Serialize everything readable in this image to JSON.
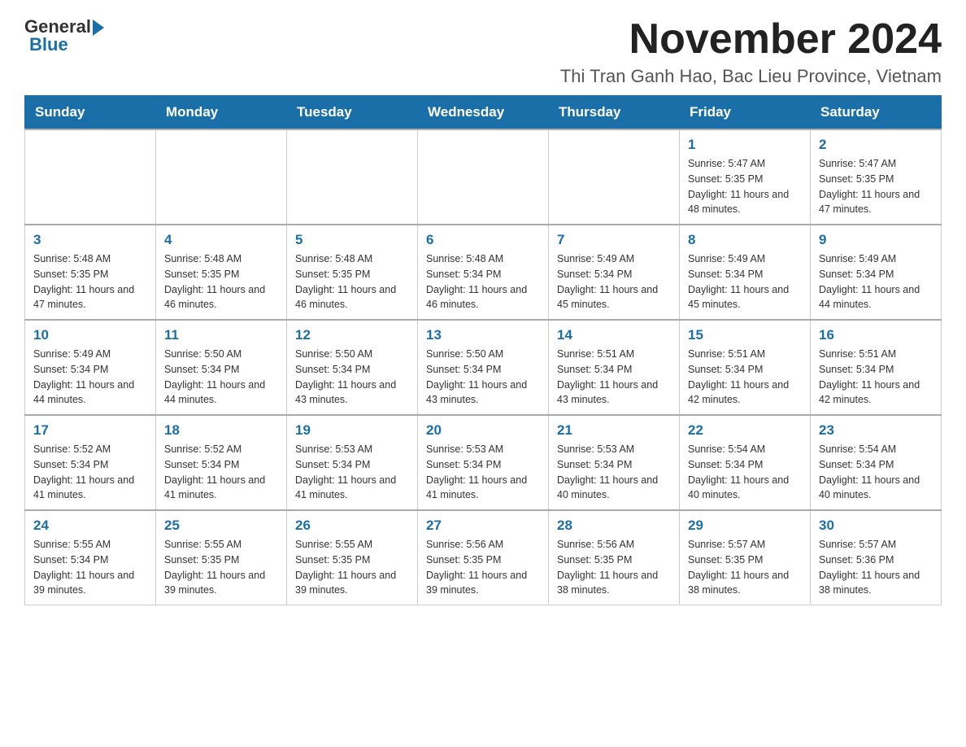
{
  "logo": {
    "general": "General",
    "blue": "Blue"
  },
  "title": "November 2024",
  "subtitle": "Thi Tran Ganh Hao, Bac Lieu Province, Vietnam",
  "days_of_week": [
    "Sunday",
    "Monday",
    "Tuesday",
    "Wednesday",
    "Thursday",
    "Friday",
    "Saturday"
  ],
  "weeks": [
    [
      {
        "day": "",
        "sunrise": "",
        "sunset": "",
        "daylight": ""
      },
      {
        "day": "",
        "sunrise": "",
        "sunset": "",
        "daylight": ""
      },
      {
        "day": "",
        "sunrise": "",
        "sunset": "",
        "daylight": ""
      },
      {
        "day": "",
        "sunrise": "",
        "sunset": "",
        "daylight": ""
      },
      {
        "day": "",
        "sunrise": "",
        "sunset": "",
        "daylight": ""
      },
      {
        "day": "1",
        "sunrise": "Sunrise: 5:47 AM",
        "sunset": "Sunset: 5:35 PM",
        "daylight": "Daylight: 11 hours and 48 minutes."
      },
      {
        "day": "2",
        "sunrise": "Sunrise: 5:47 AM",
        "sunset": "Sunset: 5:35 PM",
        "daylight": "Daylight: 11 hours and 47 minutes."
      }
    ],
    [
      {
        "day": "3",
        "sunrise": "Sunrise: 5:48 AM",
        "sunset": "Sunset: 5:35 PM",
        "daylight": "Daylight: 11 hours and 47 minutes."
      },
      {
        "day": "4",
        "sunrise": "Sunrise: 5:48 AM",
        "sunset": "Sunset: 5:35 PM",
        "daylight": "Daylight: 11 hours and 46 minutes."
      },
      {
        "day": "5",
        "sunrise": "Sunrise: 5:48 AM",
        "sunset": "Sunset: 5:35 PM",
        "daylight": "Daylight: 11 hours and 46 minutes."
      },
      {
        "day": "6",
        "sunrise": "Sunrise: 5:48 AM",
        "sunset": "Sunset: 5:34 PM",
        "daylight": "Daylight: 11 hours and 46 minutes."
      },
      {
        "day": "7",
        "sunrise": "Sunrise: 5:49 AM",
        "sunset": "Sunset: 5:34 PM",
        "daylight": "Daylight: 11 hours and 45 minutes."
      },
      {
        "day": "8",
        "sunrise": "Sunrise: 5:49 AM",
        "sunset": "Sunset: 5:34 PM",
        "daylight": "Daylight: 11 hours and 45 minutes."
      },
      {
        "day": "9",
        "sunrise": "Sunrise: 5:49 AM",
        "sunset": "Sunset: 5:34 PM",
        "daylight": "Daylight: 11 hours and 44 minutes."
      }
    ],
    [
      {
        "day": "10",
        "sunrise": "Sunrise: 5:49 AM",
        "sunset": "Sunset: 5:34 PM",
        "daylight": "Daylight: 11 hours and 44 minutes."
      },
      {
        "day": "11",
        "sunrise": "Sunrise: 5:50 AM",
        "sunset": "Sunset: 5:34 PM",
        "daylight": "Daylight: 11 hours and 44 minutes."
      },
      {
        "day": "12",
        "sunrise": "Sunrise: 5:50 AM",
        "sunset": "Sunset: 5:34 PM",
        "daylight": "Daylight: 11 hours and 43 minutes."
      },
      {
        "day": "13",
        "sunrise": "Sunrise: 5:50 AM",
        "sunset": "Sunset: 5:34 PM",
        "daylight": "Daylight: 11 hours and 43 minutes."
      },
      {
        "day": "14",
        "sunrise": "Sunrise: 5:51 AM",
        "sunset": "Sunset: 5:34 PM",
        "daylight": "Daylight: 11 hours and 43 minutes."
      },
      {
        "day": "15",
        "sunrise": "Sunrise: 5:51 AM",
        "sunset": "Sunset: 5:34 PM",
        "daylight": "Daylight: 11 hours and 42 minutes."
      },
      {
        "day": "16",
        "sunrise": "Sunrise: 5:51 AM",
        "sunset": "Sunset: 5:34 PM",
        "daylight": "Daylight: 11 hours and 42 minutes."
      }
    ],
    [
      {
        "day": "17",
        "sunrise": "Sunrise: 5:52 AM",
        "sunset": "Sunset: 5:34 PM",
        "daylight": "Daylight: 11 hours and 41 minutes."
      },
      {
        "day": "18",
        "sunrise": "Sunrise: 5:52 AM",
        "sunset": "Sunset: 5:34 PM",
        "daylight": "Daylight: 11 hours and 41 minutes."
      },
      {
        "day": "19",
        "sunrise": "Sunrise: 5:53 AM",
        "sunset": "Sunset: 5:34 PM",
        "daylight": "Daylight: 11 hours and 41 minutes."
      },
      {
        "day": "20",
        "sunrise": "Sunrise: 5:53 AM",
        "sunset": "Sunset: 5:34 PM",
        "daylight": "Daylight: 11 hours and 41 minutes."
      },
      {
        "day": "21",
        "sunrise": "Sunrise: 5:53 AM",
        "sunset": "Sunset: 5:34 PM",
        "daylight": "Daylight: 11 hours and 40 minutes."
      },
      {
        "day": "22",
        "sunrise": "Sunrise: 5:54 AM",
        "sunset": "Sunset: 5:34 PM",
        "daylight": "Daylight: 11 hours and 40 minutes."
      },
      {
        "day": "23",
        "sunrise": "Sunrise: 5:54 AM",
        "sunset": "Sunset: 5:34 PM",
        "daylight": "Daylight: 11 hours and 40 minutes."
      }
    ],
    [
      {
        "day": "24",
        "sunrise": "Sunrise: 5:55 AM",
        "sunset": "Sunset: 5:34 PM",
        "daylight": "Daylight: 11 hours and 39 minutes."
      },
      {
        "day": "25",
        "sunrise": "Sunrise: 5:55 AM",
        "sunset": "Sunset: 5:35 PM",
        "daylight": "Daylight: 11 hours and 39 minutes."
      },
      {
        "day": "26",
        "sunrise": "Sunrise: 5:55 AM",
        "sunset": "Sunset: 5:35 PM",
        "daylight": "Daylight: 11 hours and 39 minutes."
      },
      {
        "day": "27",
        "sunrise": "Sunrise: 5:56 AM",
        "sunset": "Sunset: 5:35 PM",
        "daylight": "Daylight: 11 hours and 39 minutes."
      },
      {
        "day": "28",
        "sunrise": "Sunrise: 5:56 AM",
        "sunset": "Sunset: 5:35 PM",
        "daylight": "Daylight: 11 hours and 38 minutes."
      },
      {
        "day": "29",
        "sunrise": "Sunrise: 5:57 AM",
        "sunset": "Sunset: 5:35 PM",
        "daylight": "Daylight: 11 hours and 38 minutes."
      },
      {
        "day": "30",
        "sunrise": "Sunrise: 5:57 AM",
        "sunset": "Sunset: 5:36 PM",
        "daylight": "Daylight: 11 hours and 38 minutes."
      }
    ]
  ]
}
